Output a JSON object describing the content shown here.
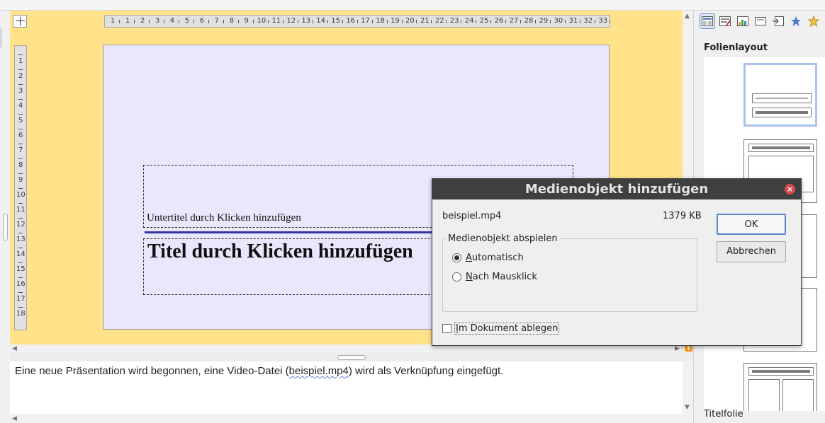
{
  "rulers": {
    "horizontal": [
      "1",
      "1",
      "2",
      "3",
      "4",
      "5",
      "6",
      "7",
      "8",
      "9",
      "10",
      "11",
      "12",
      "13",
      "14",
      "15",
      "16",
      "17",
      "18",
      "19",
      "20",
      "21",
      "22",
      "23",
      "24",
      "25",
      "26",
      "27",
      "28",
      "29",
      "30",
      "31",
      "32",
      "33"
    ],
    "vertical": [
      "1",
      "2",
      "3",
      "4",
      "5",
      "6",
      "7",
      "8",
      "9",
      "10",
      "11",
      "12",
      "13",
      "14",
      "15",
      "16",
      "17",
      "18"
    ]
  },
  "slide": {
    "subtitle_placeholder": "Untertitel durch Klicken hinzufügen",
    "title_placeholder": "Titel durch Klicken hinzufügen"
  },
  "notes": {
    "before": "Eine neue Präsentation wird begonnen, eine Video-Datei (",
    "highlight": "beispiel.mp4",
    "after": ") wird als Verknüpfung eingefügt."
  },
  "sidebar": {
    "tool_icons": [
      "properties-icon",
      "styles-icon",
      "gallery-icon",
      "master-slides-icon",
      "navigator-icon",
      "animation-icon",
      "slide-transition-icon"
    ],
    "section_title": "Folienlayout",
    "footer_label": "Titelfolie"
  },
  "dialog": {
    "title": "Medienobjekt hinzufügen",
    "file_name": "beispiel.mp4",
    "file_size": "1379 KB",
    "ok_label": "OK",
    "cancel_label": "Abbrechen",
    "group_label": "Medienobjekt abspielen",
    "option_auto": "Automatisch",
    "option_click": "Nach Mausklick",
    "selected_option": "Automatisch",
    "embed_label": "Im Dokument ablegen",
    "embed_checked": false
  },
  "colors": {
    "workarea_bg": "#ffe28a",
    "slide_bg": "#e8e7fb",
    "title_line": "#36369a",
    "dialog_titlebar": "#3f3f3f",
    "close_button": "#d54a4a"
  }
}
